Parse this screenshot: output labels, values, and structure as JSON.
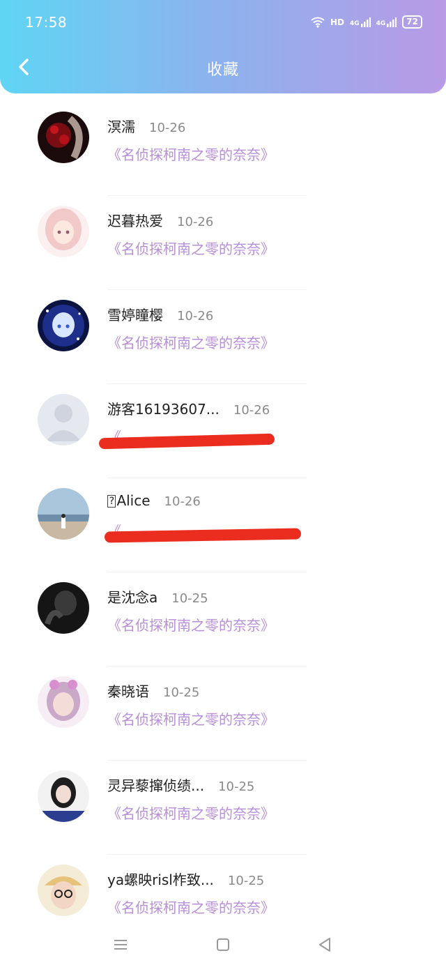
{
  "status": {
    "time": "17:58",
    "network": "HD",
    "signal1": "4G",
    "signal2": "4G",
    "battery": "72"
  },
  "header": {
    "title": "收藏",
    "back_icon": "chevron-left-icon"
  },
  "favorites": [
    {
      "name": "溟濡",
      "date": "10-26",
      "title": "《名侦探柯南之零的奈奈》"
    },
    {
      "name": "迟暮热爱",
      "date": "10-26",
      "title": "《名侦探柯南之零的奈奈》"
    },
    {
      "name": "雪婷瞳樱",
      "date": "10-26",
      "title": "《名侦探柯南之零的奈奈》"
    },
    {
      "name": "游客16193607...",
      "date": "10-26",
      "title": "《"
    },
    {
      "name": "Alice",
      "date": "10-26",
      "title": "《"
    },
    {
      "name": "是沈念a",
      "date": "10-25",
      "title": "《名侦探柯南之零的奈奈》"
    },
    {
      "name": "秦晓语",
      "date": "10-25",
      "title": "《名侦探柯南之零的奈奈》"
    },
    {
      "name": "灵异藜撺侦绩...",
      "date": "10-25",
      "title": "《名侦探柯南之零的奈奈》"
    },
    {
      "name": "ya螺映risl柞致...",
      "date": "10-25",
      "title": "《名侦探柯南之零的奈奈》"
    }
  ],
  "colors": {
    "header_gradient_start": "#5fd5f4",
    "header_gradient_end": "#b89ae6",
    "favorite_title": "#b78fd8",
    "redaction": "#ea2d1e"
  },
  "navbar": {
    "menu_icon": "menu-icon",
    "home_icon": "home-square-icon",
    "back_icon": "back-triangle-icon"
  }
}
